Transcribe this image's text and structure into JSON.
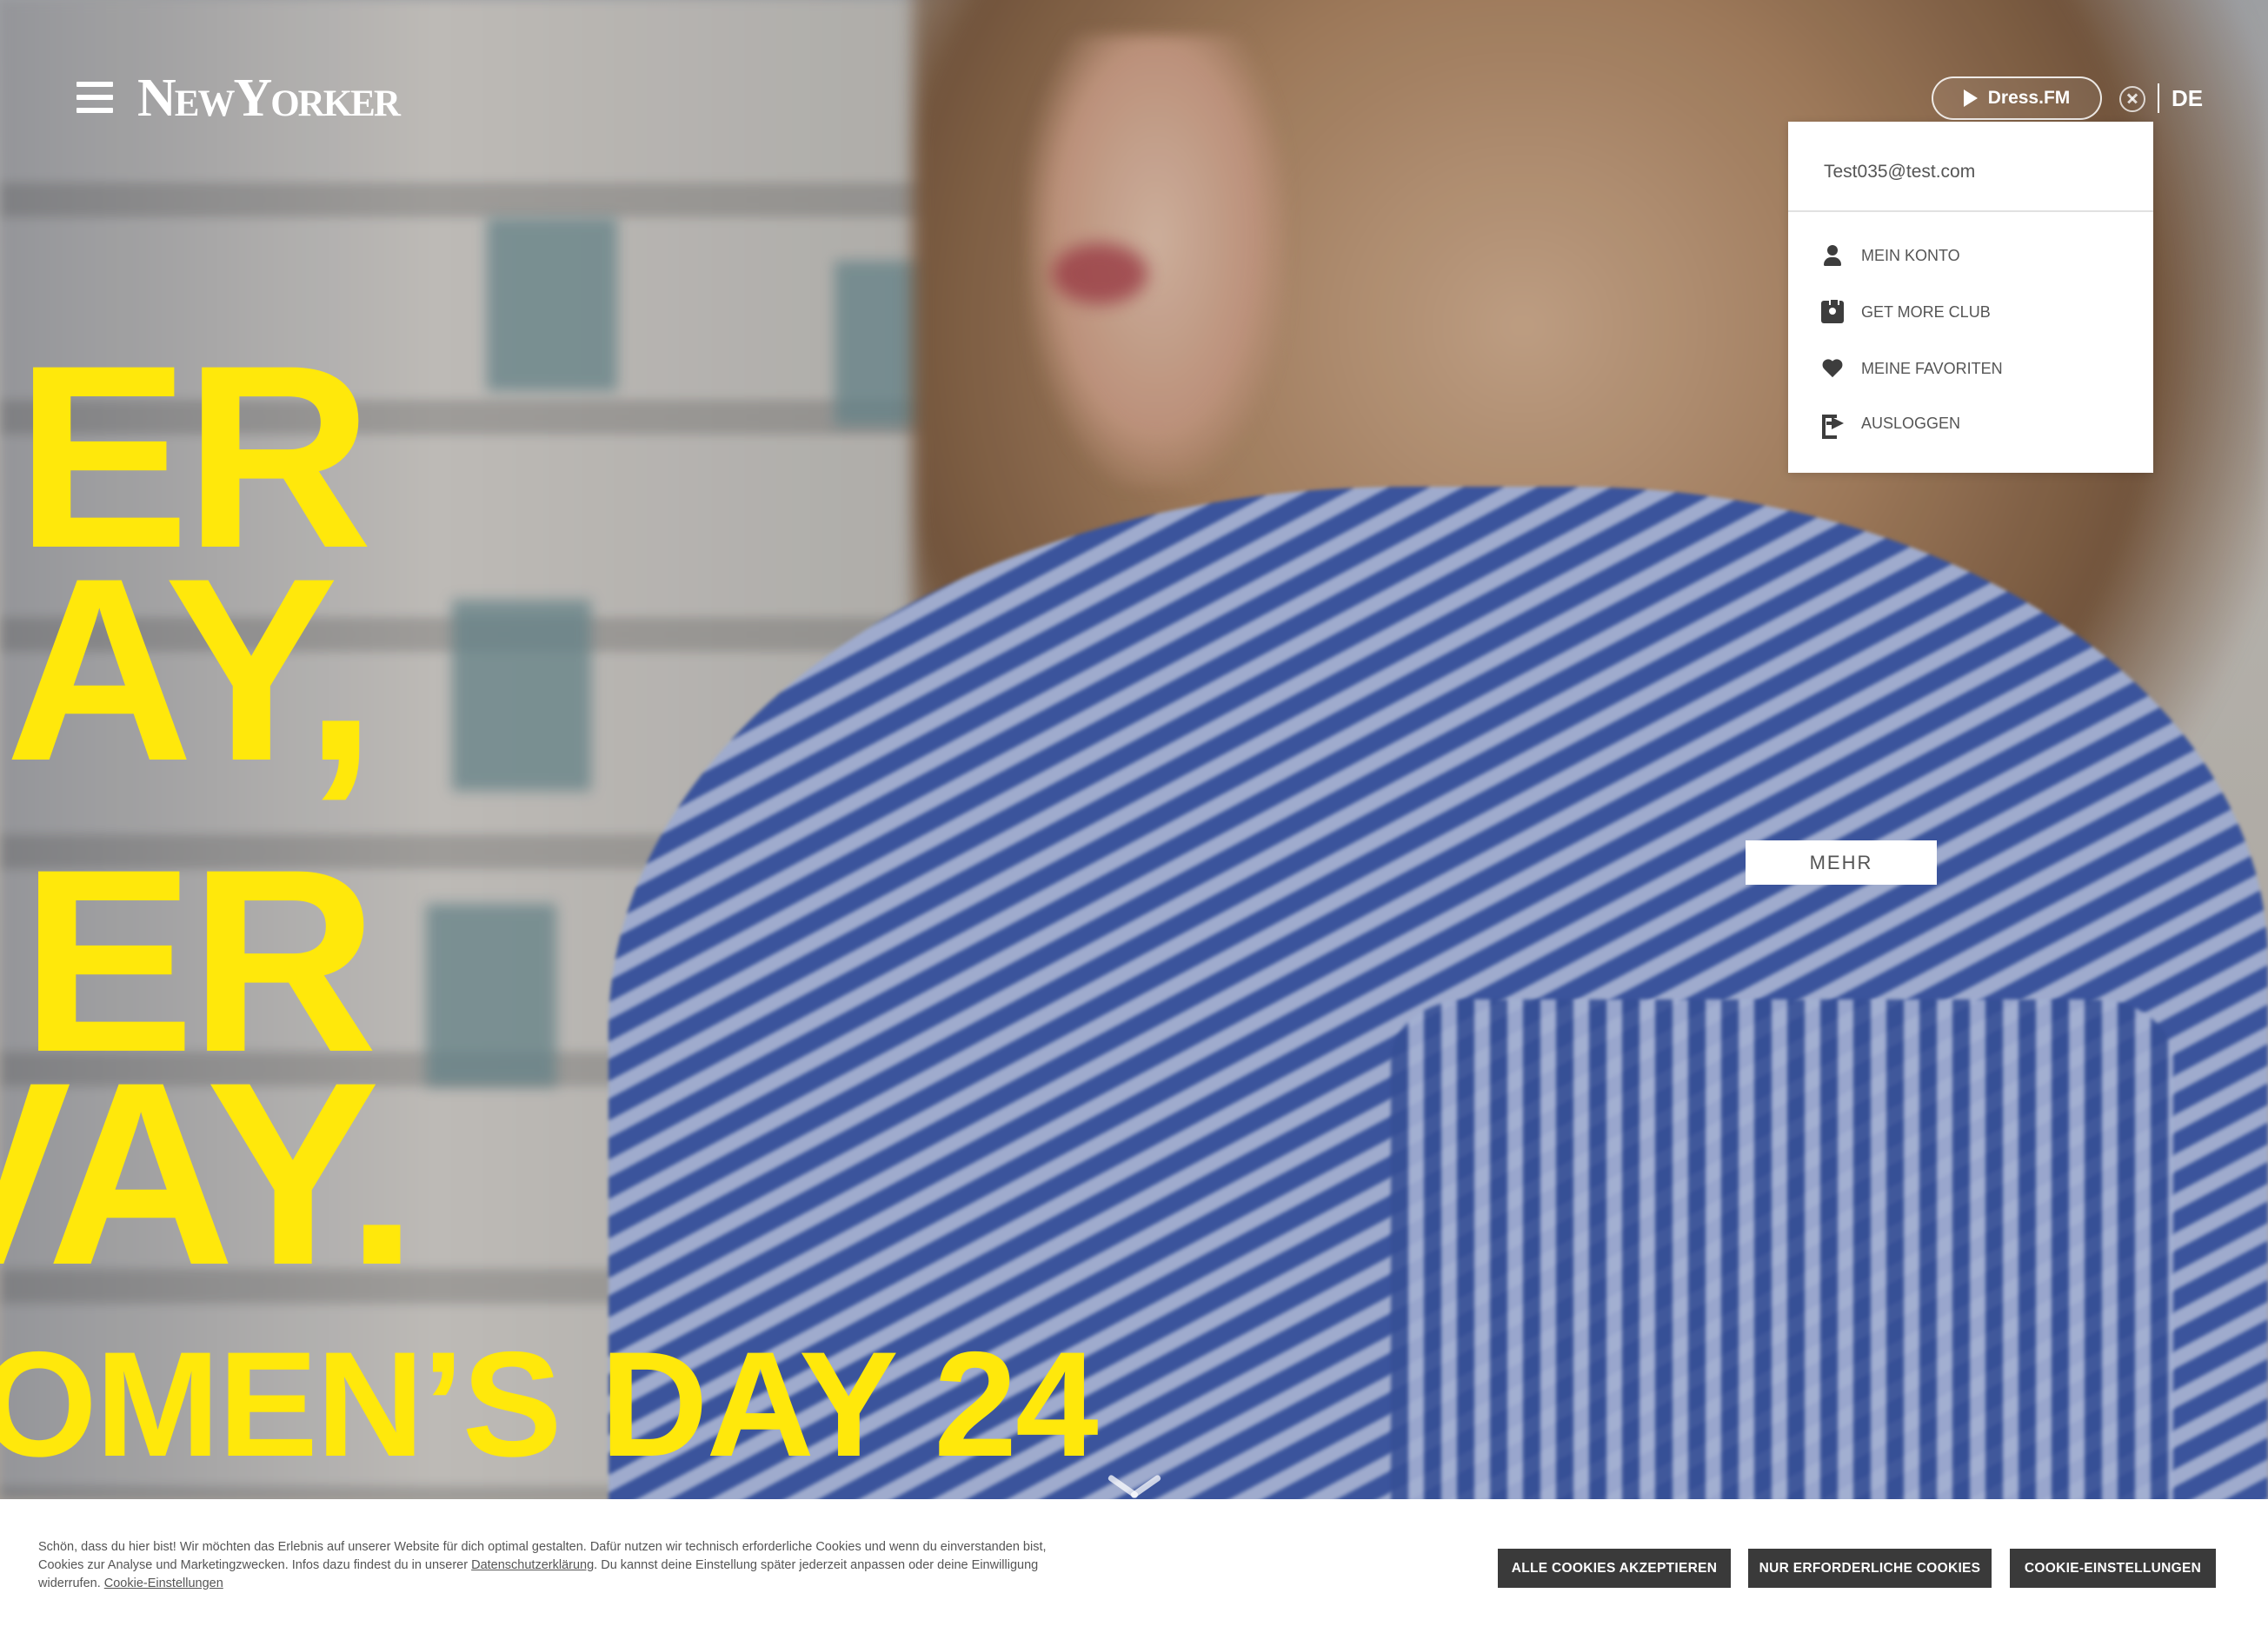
{
  "header": {
    "logo": "NewYorker",
    "dress_fm_label": "Dress.FM",
    "language": "DE"
  },
  "hero": {
    "headline_lines": [
      "ER",
      "AY,",
      "ER",
      "VAY.",
      "OMEN’S DAY 24"
    ],
    "more_button": "MEHR"
  },
  "account_menu": {
    "email": "Test035@test.com",
    "items": [
      {
        "label": "MEIN KONTO",
        "icon": "user-icon"
      },
      {
        "label": "GET MORE CLUB",
        "icon": "club-card-icon"
      },
      {
        "label": "MEINE FAVORITEN",
        "icon": "heart-icon"
      },
      {
        "label": "AUSLOGGEN",
        "icon": "logout-icon"
      }
    ]
  },
  "cookie_banner": {
    "text_part1": "Schön, dass du hier bist! Wir möchten das Erlebnis auf unserer Website für dich optimal gestalten. Dafür nutzen wir technisch erforderliche Cookies und wenn du einverstanden bist, Cookies zur Analyse und Marketingzwecken. Infos dazu findest du in unserer ",
    "privacy_link": "Datenschutzerklärung",
    "text_part2": ". Du kannst deine Einstellung später jederzeit anpassen oder deine Einwilligung widerrufen. ",
    "settings_link": "Cookie-Einstellungen",
    "accept_all": "ALLE COOKIES AKZEPTIEREN",
    "necessary_only": "NUR ERFORDERLICHE COOKIES",
    "settings": "COOKIE-EINSTELLUNGEN"
  },
  "colors": {
    "headline": "#ffe80b",
    "button_dark": "#3a3a3a",
    "text_gray": "#555555"
  }
}
